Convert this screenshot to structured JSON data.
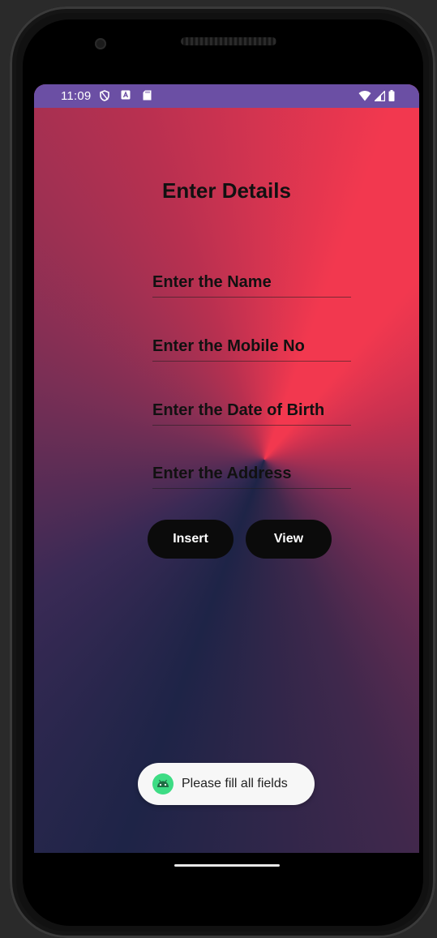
{
  "status_bar": {
    "time": "11:09",
    "left_icons": [
      "shield-icon",
      "a-box-icon",
      "sd-card-icon"
    ],
    "right_icons": [
      "wifi-icon",
      "signal-icon",
      "battery-icon"
    ],
    "color": "#6b4fa4"
  },
  "form": {
    "title": "Enter Details",
    "fields": [
      {
        "placeholder": "Enter the Name",
        "value": ""
      },
      {
        "placeholder": "Enter the Mobile No",
        "value": ""
      },
      {
        "placeholder": "Enter the Date of Birth",
        "value": ""
      },
      {
        "placeholder": "Enter the Address",
        "value": ""
      }
    ],
    "buttons": {
      "insert_label": "Insert",
      "view_label": "View"
    }
  },
  "toast": {
    "icon": "android-icon",
    "message": "Please fill all fields"
  },
  "colors": {
    "gradient_red": "#f2384f",
    "gradient_navy": "#1e2447",
    "button": "#0b0b0b",
    "toast_bg": "#f7f7f7"
  }
}
